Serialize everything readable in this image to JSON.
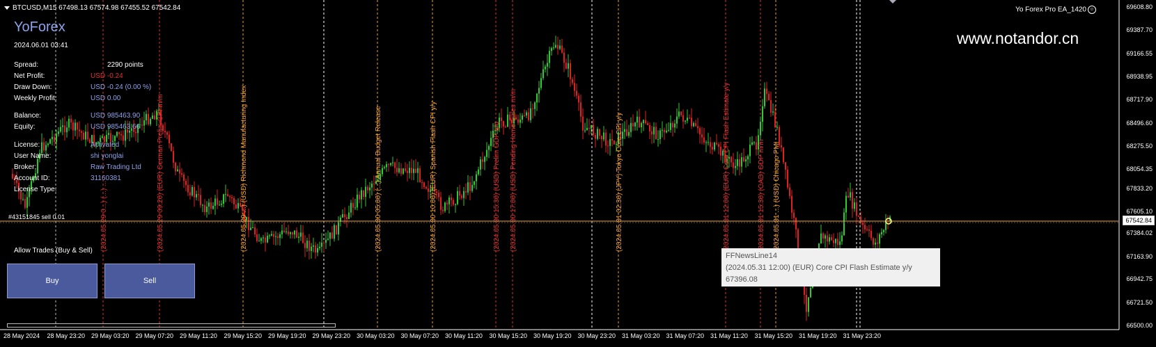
{
  "header": {
    "symbol_line": "BTCUSD,M15  67498.13 67574.98 67455.52 67542.84",
    "ea_name": "Yo Forex Pro EA_1420",
    "ea_icon": "smiley-icon"
  },
  "watermark": "www.notandor.cn",
  "panel": {
    "brand": "YoForex",
    "datetime": "2024.06.01 03:41",
    "rows": [
      {
        "label": "Spread:",
        "value": "2290 points",
        "color": "#ffffff"
      },
      {
        "label": "Net Profit:",
        "value": "USD -0.24",
        "color": "#e03030"
      },
      {
        "label": "Draw Down:",
        "value": "USD -0.24 (0.00 %)",
        "color": "#8ea2ea"
      },
      {
        "label": "Weekly Profit:",
        "value": "USD 0.00",
        "color": "#8ea2ea"
      },
      {
        "label": "Balance:",
        "value": "USD 985463.90",
        "color": "#8ea2ea"
      },
      {
        "label": "Equity:",
        "value": "USD 985463.66",
        "color": "#8ea2ea"
      },
      {
        "label": "License:",
        "value": "Activated",
        "color": "#8ea2ea"
      },
      {
        "label": "User Name:",
        "value": "shi yonglai",
        "color": "#8ea2ea"
      },
      {
        "label": "Broker:",
        "value": "Raw Trading Ltd",
        "color": "#8ea2ea"
      },
      {
        "label": "Account ID:",
        "value": "31160381",
        "color": "#8ea2ea"
      },
      {
        "label": "License Type:",
        "value": "",
        "color": "#8ea2ea"
      }
    ],
    "position_label": "#43151845 sell 0.01",
    "allow_trades": "Allow Trades (Buy & Sell)",
    "buy_label": "Buy",
    "sell_label": "Sell"
  },
  "current_price": "67542.84",
  "tooltip": {
    "title": "FFNewsLine14",
    "event": "(2024.05.31 12:00) (EUR) Core CPI Flash Estimate y/y",
    "price": "67396.08"
  },
  "colors": {
    "bull": "#2ecc2e",
    "bear": "#e02020",
    "price_line": "#f0a040",
    "news_orange": "#f0a030",
    "news_red": "#e03030"
  },
  "y_axis": [
    "69608.80",
    "69387.70",
    "69166.55",
    "68938.95",
    "68717.90",
    "68496.60",
    "68275.50",
    "68054.35",
    "67833.20",
    "67605.10",
    "67384.02",
    "67163.90",
    "66942.75",
    "66721.50",
    "66500.00"
  ],
  "x_axis": [
    "28 May 2024",
    "28 May 23:20",
    "29 May 03:20",
    "29 May 07:20",
    "29 May 11:20",
    "29 May 15:20",
    "29 May 19:20",
    "29 May 23:20",
    "30 May 03:20",
    "30 May 07:20",
    "30 May 11:20",
    "30 May 15:20",
    "30 May 19:20",
    "30 May 23:20",
    "31 May 03:20",
    "31 May 07:20",
    "31 May 11:20",
    "31 May 15:20",
    "31 May 19:20",
    "31 May 23:20"
  ],
  "news_events": [
    {
      "text": "(2024.05.29 0...) (...) ...",
      "color": "#e03030"
    },
    {
      "text": "(2024.05.29 09:20) (EUR) German Prelim CPI m/m",
      "color": "#e03030"
    },
    {
      "text": "(2024.05.29 ...) (USD) Richmond Manufacturing Index",
      "color": "#f0a030"
    },
    {
      "text": "(2024.05.30 05:00) (...) Annual Budget Release",
      "color": "#f0a030"
    },
    {
      "text": "(2024.05.30 10:00) (EUR) Spanish Flash CPI y/y",
      "color": "#f0a030"
    },
    {
      "text": "(2024.05.30 15:30) (USD) Prelim GDP q/q",
      "color": "#e03030"
    },
    {
      "text": "(2024.05.30 17:00) (USD) Pending Home Sales m/m",
      "color": "#e03030"
    },
    {
      "text": "(2024.05.31 02:30) (JPY) Tokyo Core CPI y/y",
      "color": "#f0a030"
    },
    {
      "text": "(2024.05.31 12:00) (EUR) Core CPI Flash Estimate y/y",
      "color": "#e03030"
    },
    {
      "text": "(2024.05.31 15:30) (CAD) GDP m/m",
      "color": "#e03030"
    },
    {
      "text": "(2024.05.31 ...) (USD) Chicago PMI",
      "color": "#f0a030"
    }
  ]
}
